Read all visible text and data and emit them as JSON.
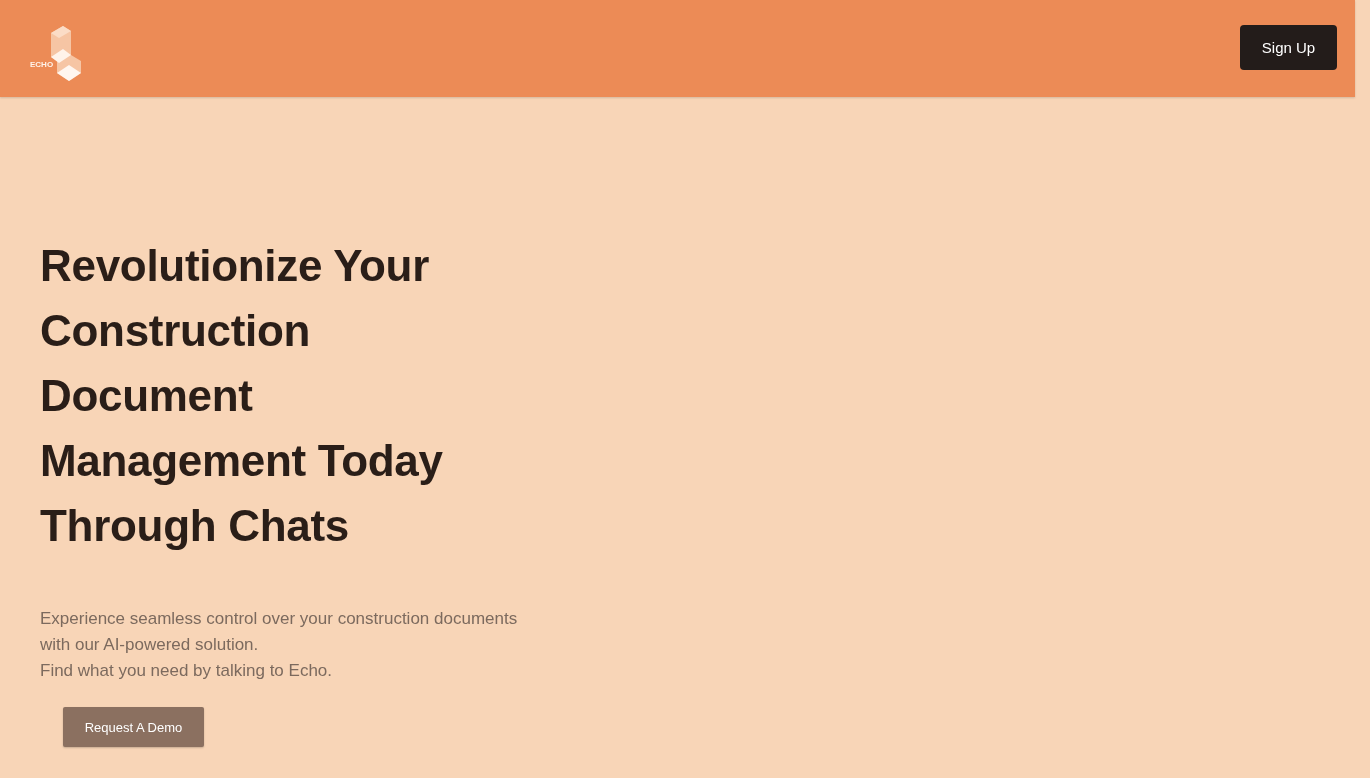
{
  "header": {
    "logo_text": "ECHO",
    "signup_button": "Sign Up"
  },
  "hero": {
    "title_lines": [
      "Revolutionize Your",
      "Construction",
      "Document",
      "Management Today",
      "Through Chats"
    ],
    "description_lines": [
      "Experience seamless control over your construction documents",
      "with our AI-powered solution.",
      "Find what you need by talking to Echo."
    ],
    "cta_button": "Request A Demo"
  }
}
